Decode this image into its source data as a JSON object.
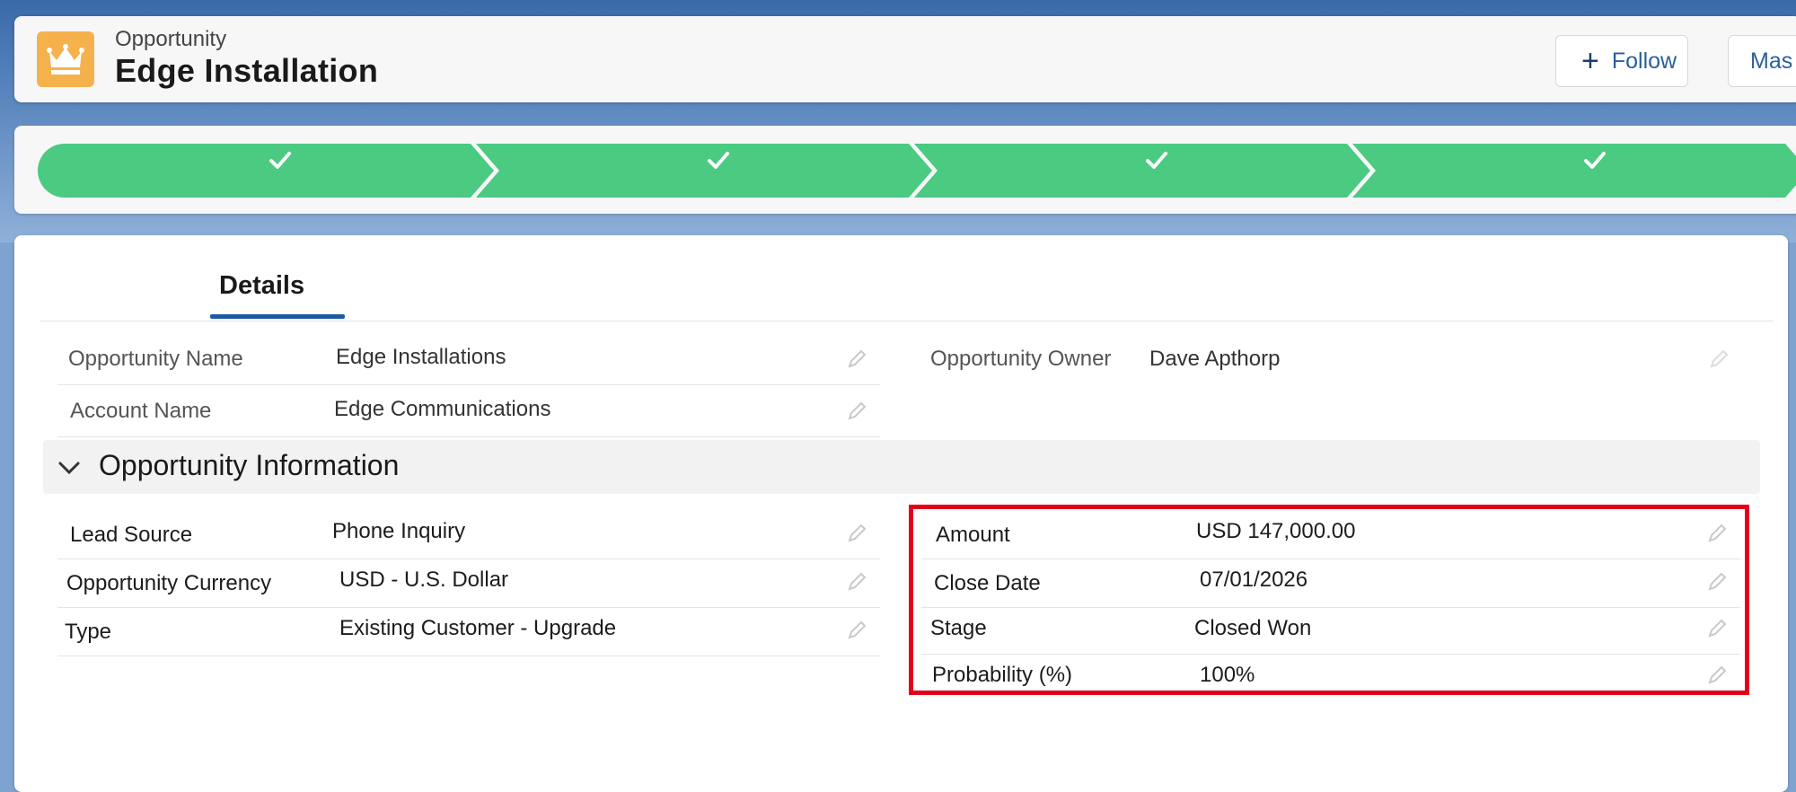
{
  "header": {
    "object_label": "Opportunity",
    "title": "Edge Installation",
    "follow_label": "Follow",
    "master_label": "Mas"
  },
  "path": {
    "steps": [
      {
        "status": "complete",
        "icon": "check-icon"
      },
      {
        "status": "complete",
        "icon": "check-icon"
      },
      {
        "status": "complete",
        "icon": "check-icon"
      },
      {
        "status": "complete",
        "icon": "check-icon"
      }
    ],
    "complete_color": "#4bca81"
  },
  "tabs": {
    "details_label": "Details"
  },
  "highlights": {
    "opportunity_name": {
      "label": "Opportunity Name",
      "value": "Edge Installations"
    },
    "account_name": {
      "label": "Account Name",
      "value": "Edge Communications"
    },
    "opportunity_owner": {
      "label": "Opportunity Owner",
      "value": "Dave Apthorp"
    }
  },
  "section": {
    "title": "Opportunity Information",
    "left_fields": [
      {
        "label": "Lead Source",
        "value": "Phone Inquiry"
      },
      {
        "label": "Opportunity Currency",
        "value": "USD - U.S. Dollar"
      },
      {
        "label": "Type",
        "value": "Existing Customer - Upgrade"
      }
    ],
    "right_fields": [
      {
        "label": "Amount",
        "value": "USD 147,000.00"
      },
      {
        "label": "Close Date",
        "value": "07/01/2026"
      },
      {
        "label": "Stage",
        "value": "Closed Won"
      },
      {
        "label": "Probability (%)",
        "value": "100%"
      }
    ]
  },
  "colors": {
    "highlight_border": "#e3001b",
    "brand_icon": "#f5b24c",
    "tab_accent": "#1b5aa3"
  }
}
